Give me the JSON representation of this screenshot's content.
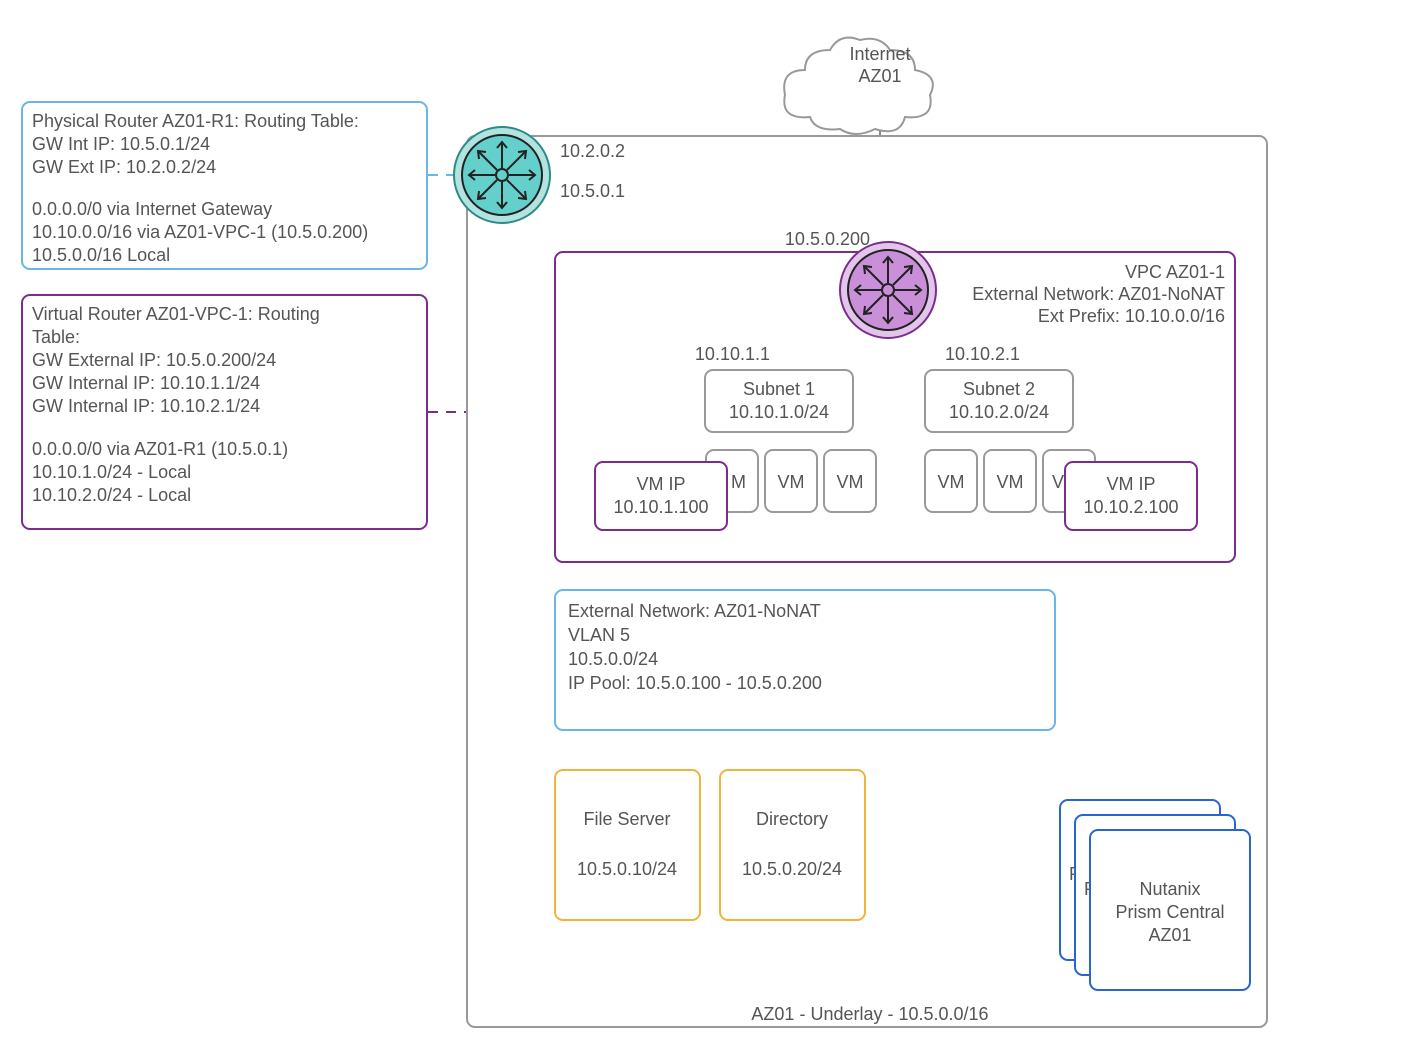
{
  "internet": {
    "line1": "Internet",
    "line2": "AZ01"
  },
  "physRouter": {
    "title": "Physical Router AZ01-R1: Routing Table:",
    "l1": "GW Int IP: 10.5.0.1/24",
    "l2": "GW Ext IP: 10.2.0.2/24",
    "r1": "0.0.0.0/0 via Internet Gateway",
    "r2": "10.10.0.0/16 via AZ01-VPC-1 (10.5.0.200)",
    "r3": "10.5.0.0/16 Local"
  },
  "virtRouter": {
    "title1": "Virtual Router AZ01-VPC-1: Routing",
    "title2": "Table:",
    "l1": "GW External IP: 10.5.0.200/24",
    "l2": "GW Internal IP: 10.10.1.1/24",
    "l3": "GW Internal IP: 10.10.2.1/24",
    "r1": "0.0.0.0/0 via AZ01-R1 (10.5.0.1)",
    "r2": "10.10.1.0/24 - Local",
    "r3": "10.10.2.0/24 - Local"
  },
  "ips": {
    "ext": "10.2.0.2",
    "int": "10.5.0.1",
    "vpcExt": "10.5.0.200",
    "sn1gw": "10.10.1.1",
    "sn2gw": "10.10.2.1"
  },
  "vpc": {
    "title": "VPC AZ01-1",
    "extnet": "External Network: AZ01-NoNAT",
    "extprefix": "Ext Prefix: 10.10.0.0/16"
  },
  "subnet1": {
    "name": "Subnet 1",
    "cidr": "10.10.1.0/24"
  },
  "subnet2": {
    "name": "Subnet 2",
    "cidr": "10.10.2.0/24"
  },
  "vm": {
    "label": "VM",
    "ipLabel": "VM IP",
    "ip1": "10.10.1.100",
    "ip2": "10.10.2.100"
  },
  "extnet": {
    "l1": "External Network: AZ01-NoNAT",
    "l2": "VLAN 5",
    "l3": "10.5.0.0/24",
    "l4": "IP Pool: 10.5.0.100 - 10.5.0.200"
  },
  "fileserver": {
    "name": "File Server",
    "ip": "10.5.0.10/24"
  },
  "directory": {
    "name": "Directory",
    "ip": "10.5.0.20/24"
  },
  "prism": {
    "l1": "Nutanix",
    "l2": "Prism Central",
    "l3": "AZ01",
    "p1": "P",
    "p2": "P"
  },
  "underlay": "AZ01 - Underlay - 10.5.0.0/16"
}
